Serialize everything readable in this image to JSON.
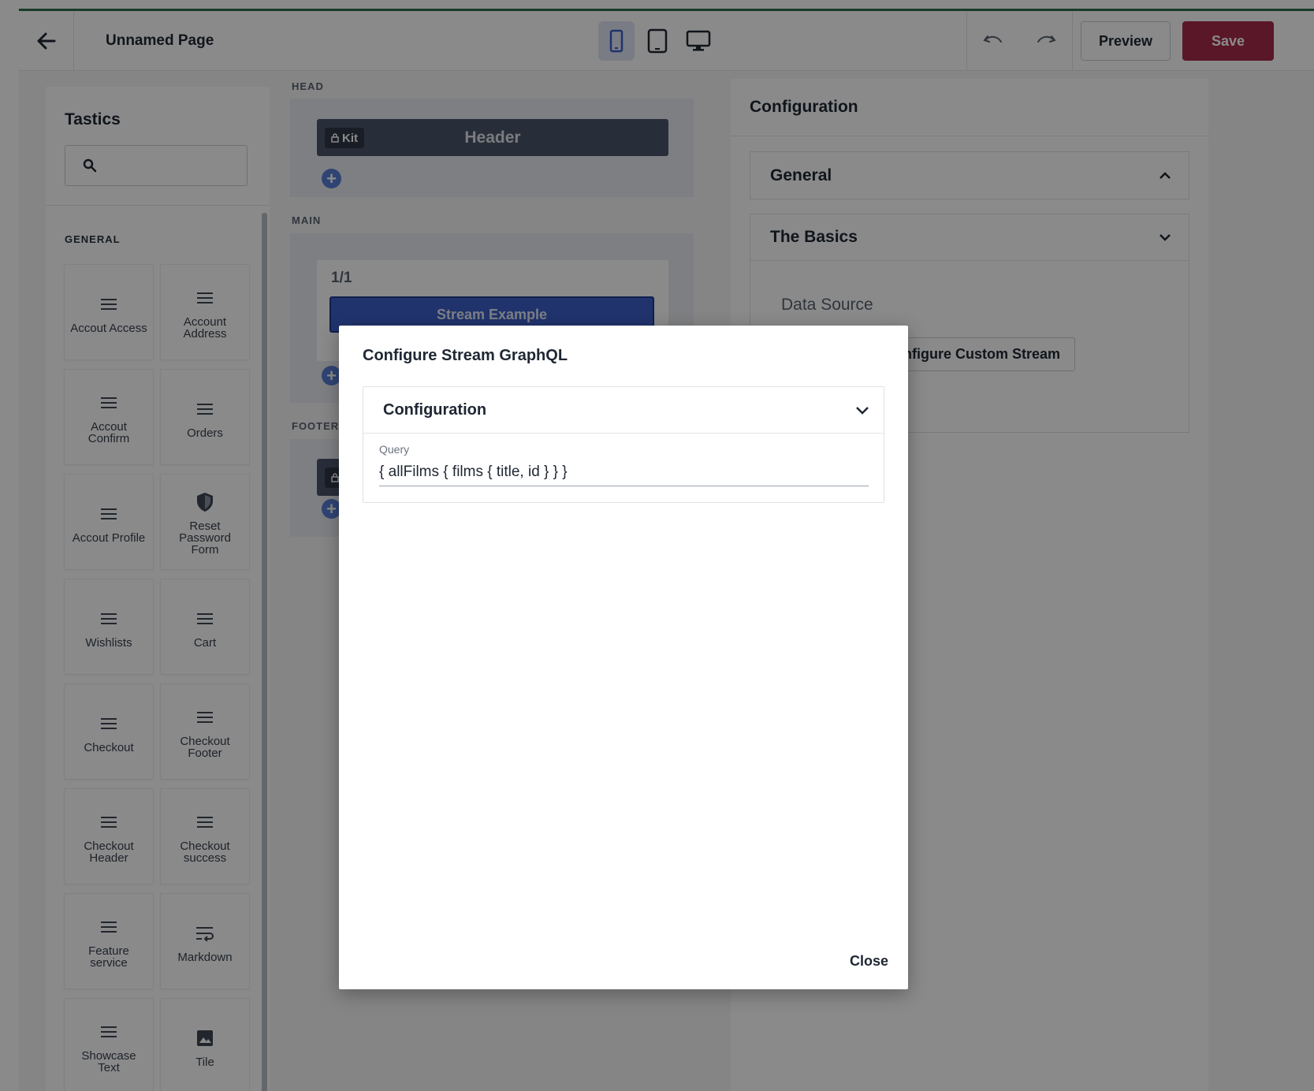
{
  "header": {
    "page_title": "Unnamed Page",
    "preview_label": "Preview",
    "save_label": "Save",
    "devices": [
      "mobile-icon",
      "tablet-icon",
      "desktop-icon"
    ],
    "active_device": "mobile",
    "colors": {
      "save": "#a52b4a",
      "top_border": "#2f6b4f"
    }
  },
  "sidebar": {
    "title": "Tastics",
    "section": "GENERAL",
    "tiles": [
      {
        "label": "Accout Access",
        "icon": "menu-lines-icon"
      },
      {
        "label": "Account Address",
        "icon": "menu-lines-icon"
      },
      {
        "label": "Accout Confirm",
        "icon": "menu-lines-icon"
      },
      {
        "label": "Orders",
        "icon": "menu-lines-icon"
      },
      {
        "label": "Accout Profile",
        "icon": "menu-lines-icon"
      },
      {
        "label": "Reset Password Form",
        "icon": "shield-icon"
      },
      {
        "label": "Wishlists",
        "icon": "menu-lines-icon"
      },
      {
        "label": "Cart",
        "icon": "menu-lines-icon"
      },
      {
        "label": "Checkout",
        "icon": "menu-lines-icon"
      },
      {
        "label": "Checkout Footer",
        "icon": "menu-lines-icon"
      },
      {
        "label": "Checkout Header",
        "icon": "menu-lines-icon"
      },
      {
        "label": "Checkout success",
        "icon": "menu-lines-icon"
      },
      {
        "label": "Feature service",
        "icon": "menu-lines-icon"
      },
      {
        "label": "Markdown",
        "icon": "wrap-text-icon"
      },
      {
        "label": "Showcase Text",
        "icon": "menu-lines-icon"
      },
      {
        "label": "Tile",
        "icon": "image-icon"
      }
    ]
  },
  "canvas": {
    "head_label": "HEAD",
    "main_label": "MAIN",
    "footer_label": "FOOTER",
    "kit_badge": "Kit",
    "header_block": "Header",
    "cell_label": "1/1",
    "stream_block": "Stream Example"
  },
  "config": {
    "title": "Configuration",
    "general": "General",
    "basics": "The Basics",
    "data_source_label": "Data Source",
    "custom_stream_button": "Configure Custom Stream"
  },
  "modal": {
    "title": "Configure Stream GraphQL",
    "panel_title": "Configuration",
    "query_label": "Query",
    "query_value": "{ allFilms { films { title, id } } }",
    "close_label": "Close"
  }
}
